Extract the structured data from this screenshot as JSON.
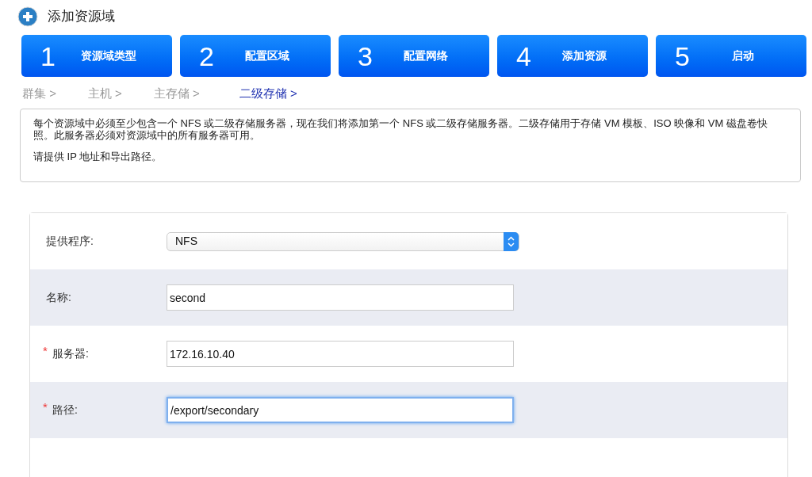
{
  "header": {
    "title": "添加资源域"
  },
  "steps": [
    {
      "number": "1",
      "label": "资源域类型"
    },
    {
      "number": "2",
      "label": "配置区域"
    },
    {
      "number": "3",
      "label": "配置网络"
    },
    {
      "number": "4",
      "label": "添加资源"
    },
    {
      "number": "5",
      "label": "启动"
    }
  ],
  "substeps": [
    {
      "label": "群集",
      "arrow": ">",
      "selected": false
    },
    {
      "label": "主机",
      "arrow": ">",
      "selected": false
    },
    {
      "label": "主存储",
      "arrow": ">",
      "selected": false
    },
    {
      "label": "二级存储",
      "arrow": ">",
      "selected": true
    }
  ],
  "info": [
    "每个资源域中必须至少包含一个 NFS 或二级存储服务器，现在我们将添加第一个 NFS 或二级存储服务器。二级存储用于存储 VM 模板、ISO 映像和 VM 磁盘卷快照。此服务器必须对资源域中的所有服务器可用。",
    "请提供 IP 地址和导出路径。"
  ],
  "form": [
    {
      "kind": "select",
      "label": "提供程序:",
      "value": "NFS",
      "focused": false
    },
    {
      "kind": "text",
      "label": "名称:",
      "value": "second",
      "focused": false
    },
    {
      "kind": "text",
      "label": "服务器:",
      "value": "172.16.10.40",
      "required_mark": "*",
      "focused": false
    },
    {
      "kind": "text",
      "label": "路径:",
      "value": "/export/secondary",
      "required_mark": "*",
      "focused": true
    }
  ]
}
